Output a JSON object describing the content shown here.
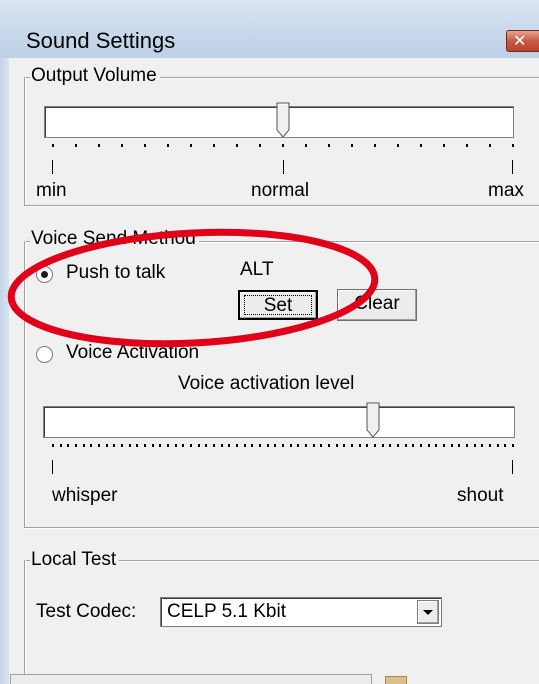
{
  "window": {
    "title": "Sound Settings",
    "close_glyph": "✕"
  },
  "output_volume": {
    "group_label": "Output Volume",
    "level": 0.5,
    "min_label": "min",
    "normal_label": "normal",
    "max_label": "max"
  },
  "voice_send": {
    "group_label": "Voice Send Method",
    "push_to_talk": {
      "label": "Push to talk",
      "selected": true,
      "hotkey": "ALT"
    },
    "set_button": "Set",
    "clear_button": "Clear",
    "voice_activation": {
      "label": "Voice Activation",
      "selected": false,
      "level_title": "Voice activation level",
      "level": 0.7,
      "whisper_label": "whisper",
      "shout_label": "shout"
    }
  },
  "local_test": {
    "group_label": "Local Test",
    "codec_label": "Test Codec:",
    "codec_value": "CELP 5.1 Kbit"
  },
  "colors": {
    "annotation_red": "#e0001a",
    "titlebar": "#c9d8ea",
    "dialog_bg": "#f0f0f0"
  },
  "icons": {
    "close": "close-icon",
    "dropdown": "chevron-down-icon"
  }
}
